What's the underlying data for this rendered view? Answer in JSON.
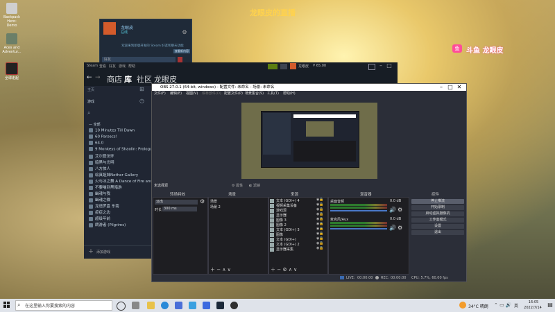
{
  "desktop": {
    "icons": [
      {
        "label": "Backpack Hero: Demo",
        "color": "#c9c9c9"
      },
      {
        "label": "Aces and Adventur...",
        "color": "#6b7f68"
      },
      {
        "label": "全球走起",
        "color": "#222222"
      }
    ],
    "watermark_top": "龙眼皮的直播",
    "watermark_right": "斗鱼 龙眼皮",
    "watermark_logo": "鱼"
  },
  "friends": {
    "user": "龙眼皮",
    "status": "在线",
    "notice": "欢迎来到新版开发的 Steam 好友和聊天功能",
    "notice_link": "查看新内容",
    "search": "好友"
  },
  "steam": {
    "top_menu": [
      "Steam",
      "查看",
      "好友",
      "游戏",
      "帮助"
    ],
    "nav": [
      "商店",
      "库",
      "社区",
      "龙眼皮"
    ],
    "account": "龙眼皮",
    "balance": "¥ 65.00",
    "home": "主页",
    "category": "游戏",
    "all_label": "— 全部",
    "games": [
      "10 Minutes Till Dawn",
      "60 Parsecs!",
      "64.0",
      "9 Monkeys of Shaolin: Prologue",
      "艾尔登法环",
      "暗黑与光明",
      "八方旅人",
      "绘真姐妹Nether Gallery",
      "火与冰之舞 A Dance of Fire and Ice",
      "不要喵到黑暗游",
      "幽魂与我",
      "幽魂之微",
      "龙语罗盘 东南",
      "疫症之边",
      "超级年前",
      "朗游者 (Pilgrims)"
    ],
    "add_game": "添加游戏"
  },
  "obs": {
    "title": "OBS 27.0.1 (64-bit, windows) - 配置文件: 未命名 - 场景: 未命名",
    "menu": [
      "文件(F)",
      "编辑(E)",
      "视图(V)",
      "停靠部件(D)",
      "配置文件(P)",
      "场景集合(S)",
      "工具(T)",
      "帮助(H)"
    ],
    "no_source": "未选择源",
    "props_btn": "属性",
    "filters_btn": "滤镜",
    "transition_header": "转场特效",
    "transition_value": "淡出",
    "duration_label": "时长",
    "duration_value": "300 ms",
    "scenes_header": "场景",
    "scenes": [
      "场景",
      "场景 2"
    ],
    "sources_header": "来源",
    "sources": [
      "文本 (GDI+) 4",
      "视频采集设备",
      "游戏源",
      "显示器",
      "图像 3",
      "图像 2",
      "文本 (GDI+) 3",
      "图像",
      "文本 (GDI+)",
      "文本 (GDI+) 2",
      "显示器采集"
    ],
    "mixer_header": "混音器",
    "mixer": [
      {
        "name": "桌面音频",
        "db": "0.0 dB"
      },
      {
        "name": "麦克风/Aux",
        "db": "0.0 dB"
      }
    ],
    "controls_header": "控件",
    "controls": [
      "停止推流",
      "开始录制",
      "启动虚拟摄像机",
      "工作室模式",
      "设置",
      "退出"
    ],
    "status": {
      "live_label": "LIVE:",
      "live_time": "00:00:00",
      "rec_label": "REC:",
      "rec_time": "00:00:00",
      "cpu": "CPU: 5.7%, 60.00 fps"
    }
  },
  "taskbar": {
    "search_placeholder": "在这里输入你要搜索的内容",
    "weather": "34°C 晴朗",
    "ime": "英",
    "time": "16:05",
    "date": "2022/7/14"
  }
}
